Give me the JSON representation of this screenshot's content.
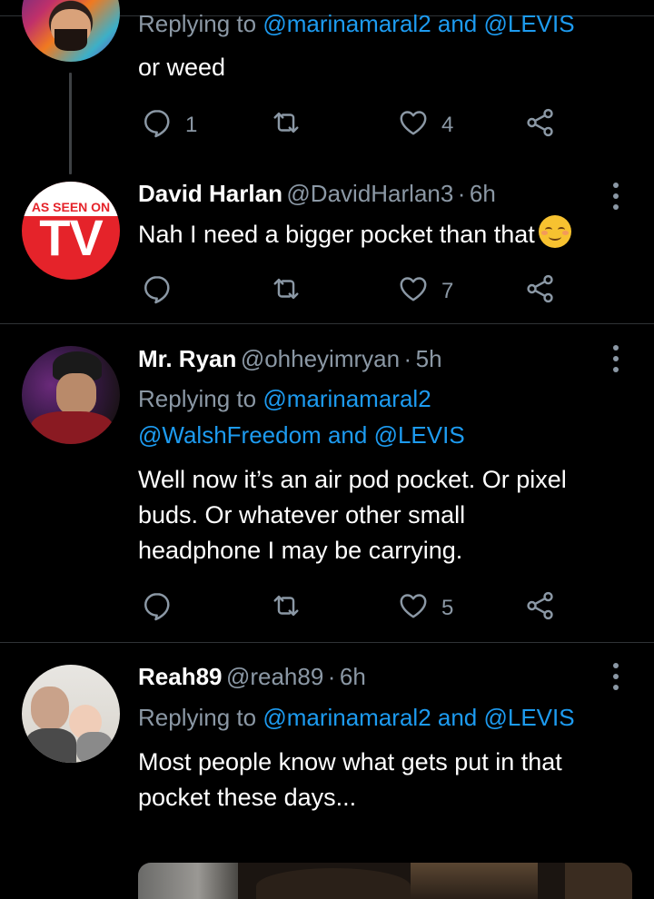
{
  "tweets": [
    {
      "reply_prefix": "Replying to",
      "reply_mentions": "@marinamaral2 and @LEVIS",
      "text": "or weed",
      "replies": "1",
      "retweets": "",
      "likes": "4"
    },
    {
      "name": "David Harlan",
      "handle": "@DavidHarlan3",
      "dot": "·",
      "time": "6h",
      "text": "Nah I need a bigger pocket than that",
      "emoji": "smiling-face-icon",
      "avatar_text_top": "AS SEEN ON",
      "avatar_text_main": "TV",
      "replies": "",
      "retweets": "",
      "likes": "7"
    },
    {
      "name": "Mr. Ryan",
      "handle": "@ohheyimryan",
      "dot": "·",
      "time": "5h",
      "reply_prefix": "Replying to",
      "reply_mention_1": "@marinamaral2",
      "reply_mention_2": "@WalshFreedom",
      "reply_and": "and",
      "reply_mention_3": "@LEVIS",
      "text_lines": [
        "Well now it’s an air pod pocket. Or pixel",
        "buds. Or whatever other small",
        "headphone I may be carrying."
      ],
      "replies": "",
      "retweets": "",
      "likes": "5"
    },
    {
      "name": "Reah89",
      "handle": "@reah89",
      "dot": "·",
      "time": "6h",
      "reply_prefix": "Replying to",
      "reply_mentions": "@marinamaral2 and @LEVIS",
      "text_lines": [
        "Most people know what gets put in that",
        "pocket these days..."
      ]
    }
  ],
  "colors": {
    "background": "#000000",
    "text": "#ffffff",
    "secondary": "#8b98a5",
    "link": "#1d9bf0",
    "divider": "#2f3336"
  },
  "icons": {
    "reply": "reply-icon",
    "retweet": "retweet-icon",
    "like": "heart-icon",
    "share": "share-icon",
    "more": "more-options-icon"
  }
}
